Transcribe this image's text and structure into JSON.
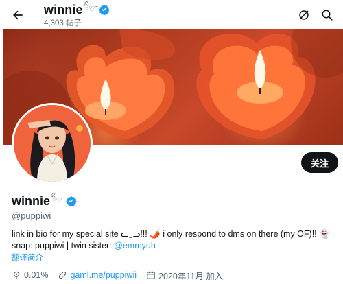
{
  "header": {
    "name": "winnie",
    "name_decor": "ིྀ♡ ̆̈",
    "post_count": "4,303 帖子"
  },
  "profile": {
    "name": "winnie",
    "name_decor": "ིྀ♡ ̆̈",
    "handle": "@puppiwi",
    "follow_label": "关注"
  },
  "bio": {
    "line1": "link in bio for my special site ᓚ ̫ ᓗ!!! 🌶️ i only respond to dms on there (my OF)!! 👻 snap: puppiwi | twin sister: ",
    "mention": "@emmyuh",
    "translate_label": "翻译简介"
  },
  "meta": {
    "stat": "0.01%",
    "link": "gaml.me/puppiwii",
    "joined": "2020年11月 加入"
  },
  "colors": {
    "accent": "#1d9bf0",
    "button": "#0f1419",
    "muted": "#536471",
    "banner": "#b13c20"
  },
  "icons": [
    "back-arrow-icon",
    "verified-badge-icon",
    "grok-icon",
    "search-icon",
    "sparkle-icon",
    "link-icon",
    "calendar-icon"
  ]
}
